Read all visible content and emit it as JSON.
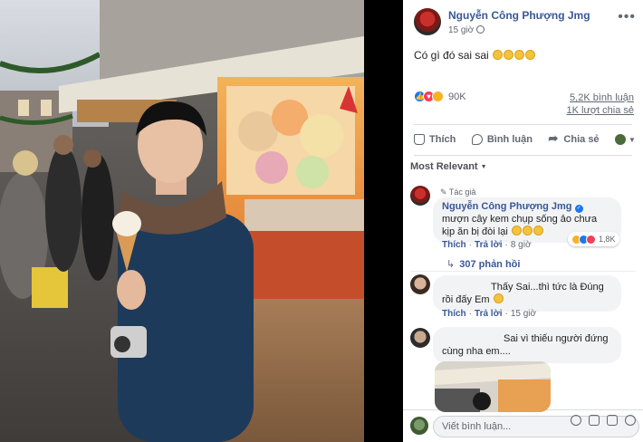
{
  "post": {
    "author": "Nguyễn Công Phượng Jmg",
    "time": "15 giờ",
    "text": "Có gì đó sai sai",
    "reaction_count": "90K",
    "comments_count": "5,2K bình luận",
    "shares_count": "1K lượt chia sẻ"
  },
  "actions": {
    "like": "Thích",
    "comment": "Bình luận",
    "share": "Chia sẻ"
  },
  "sort": {
    "label": "Most Relevant"
  },
  "comments": [
    {
      "tag": "Tác giả",
      "author": "Nguyễn Công Phượng Jmg",
      "text": "mượn cây kem chụp sống ảo chưa kịp ăn bị đòi lại",
      "like": "Thích",
      "reply": "Trả lời",
      "time": "8 giờ",
      "reactions": "1,8K",
      "replies": "307 phản hồi"
    },
    {
      "text_1": "Thấy Sai...thì tức là Đúng",
      "text_2": "rồi đấy Em",
      "like": "Thích",
      "reply": "Trả lời",
      "time": "15 giờ"
    },
    {
      "text_1": "Sai vì thiếu người đứng",
      "text_2": "cùng nha em....",
      "like": "",
      "reply": "",
      "time": ""
    }
  ],
  "composer": {
    "placeholder": "Viết bình luận..."
  },
  "colors": {
    "link": "#385898",
    "accent": "#1877f2",
    "muted": "#606770"
  },
  "icons": [
    "globe-icon",
    "more-icon",
    "like-icon",
    "comment-icon",
    "share-icon",
    "emoji-icon",
    "camera-icon",
    "gif-icon",
    "sticker-icon"
  ]
}
